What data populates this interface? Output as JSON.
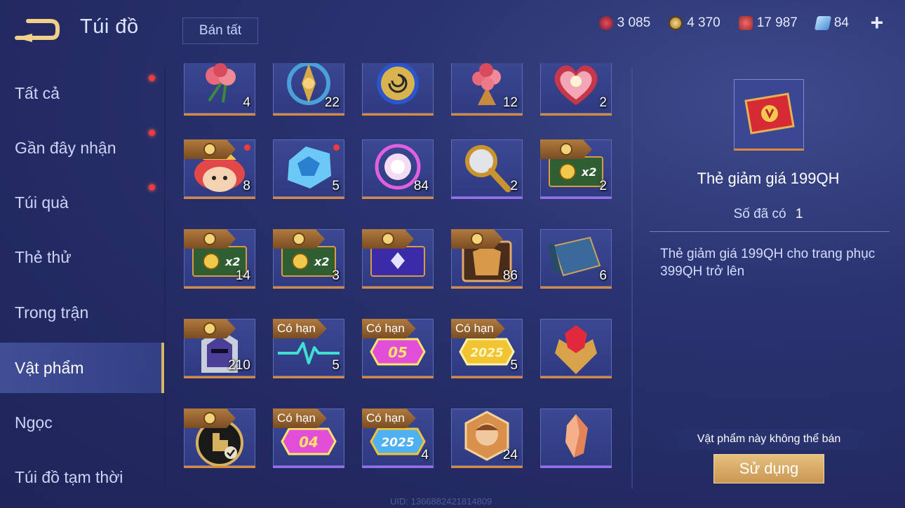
{
  "header": {
    "title": "Túi đồ",
    "sell_all": "Bán tất",
    "currencies": [
      {
        "name": "ruby-fragment",
        "value": "3 085",
        "color": "#c9344a"
      },
      {
        "name": "gold",
        "value": "4 370",
        "color": "#d9b15a"
      },
      {
        "name": "vouchers",
        "value": "17 987",
        "color": "#d8484f"
      },
      {
        "name": "tickets",
        "value": "84",
        "color": "#8fc6ff"
      }
    ],
    "plus": "+"
  },
  "sidebar": {
    "items": [
      {
        "label": "Tất cả",
        "dot": true
      },
      {
        "label": "Gần đây nhận",
        "dot": true
      },
      {
        "label": "Túi quà",
        "dot": true
      },
      {
        "label": "Thẻ thử",
        "dot": false
      },
      {
        "label": "Trong trận",
        "dot": false
      },
      {
        "label": "Vật phẩm",
        "dot": false,
        "active": true
      },
      {
        "label": "Ngọc",
        "dot": false
      },
      {
        "label": "Túi đồ tạm thời",
        "dot": false
      }
    ]
  },
  "grid": {
    "rows": [
      [
        {
          "icon": "roses-icon",
          "qty": "4",
          "rarity": "orange"
        },
        {
          "icon": "golden-crest-icon",
          "qty": "22",
          "rarity": "orange"
        },
        {
          "icon": "spiral-coin-icon",
          "qty": "",
          "rarity": "orange"
        },
        {
          "icon": "rose-bouquet-icon",
          "qty": "12",
          "rarity": "orange"
        },
        {
          "icon": "heart-gift-box-icon",
          "qty": "2",
          "rarity": "orange"
        }
      ],
      [
        {
          "icon": "lion-dance-icon",
          "qty": "8",
          "rarity": "orange",
          "tag": "coin",
          "dot": true
        },
        {
          "icon": "ice-crystal-icon",
          "qty": "5",
          "rarity": "orange",
          "dot": true
        },
        {
          "icon": "pink-orb-icon",
          "qty": "84",
          "rarity": "orange"
        },
        {
          "icon": "magnifier-scepter-icon",
          "qty": "2",
          "rarity": "purple"
        },
        {
          "icon": "gold-card-x2-icon",
          "qty": "2",
          "rarity": "purple",
          "tag": "coin",
          "card": "x2"
        }
      ],
      [
        {
          "icon": "gold-card-x2-icon",
          "qty": "14",
          "rarity": "orange",
          "tag": "coin",
          "card": "x2"
        },
        {
          "icon": "gold-card-x2-icon",
          "qty": "3",
          "rarity": "orange",
          "tag": "coin",
          "card": "x2"
        },
        {
          "icon": "purple-card-icon",
          "qty": "",
          "rarity": "orange",
          "tag": "coin"
        },
        {
          "icon": "golden-armor-chest-icon",
          "qty": "86",
          "rarity": "orange",
          "tag": "coin"
        },
        {
          "icon": "scroll-map-icon",
          "qty": "6",
          "rarity": "orange"
        }
      ],
      [
        {
          "icon": "knight-helmet-icon",
          "qty": "210",
          "rarity": "orange",
          "tag": "coin"
        },
        {
          "icon": "heartbeat-line-icon",
          "qty": "5",
          "rarity": "orange",
          "tag": "limited"
        },
        {
          "icon": "badge-05-icon",
          "qty": "",
          "rarity": "orange",
          "tag": "limited",
          "badge": "05"
        },
        {
          "icon": "badge-2025-icon",
          "qty": "5",
          "rarity": "orange",
          "tag": "limited",
          "badge": "2025"
        },
        {
          "icon": "ruby-emblem-icon",
          "qty": "",
          "rarity": "orange"
        }
      ],
      [
        {
          "icon": "tap-check-icon",
          "qty": "",
          "rarity": "orange",
          "tag": "coin"
        },
        {
          "icon": "badge-04-icon",
          "qty": "",
          "rarity": "purple",
          "tag": "limited",
          "badge": "04"
        },
        {
          "icon": "badge-2025-blue-icon",
          "qty": "4",
          "rarity": "purple",
          "tag": "limited",
          "badge": "2025"
        },
        {
          "icon": "hero-portrait-icon",
          "qty": "24",
          "rarity": "orange"
        },
        {
          "icon": "copper-crystal-icon",
          "qty": "",
          "rarity": "purple"
        }
      ]
    ],
    "limited_label": "Có hạn"
  },
  "detail": {
    "name": "Thẻ giảm giá 199QH",
    "owned_label": "Số đã có",
    "owned_value": "1",
    "description": "Thẻ giảm giá 199QH cho trang phục 399QH trở lên",
    "not_sellable": "Vật phẩm này không thể bán",
    "use_button": "Sử dụng",
    "icon": "discount-ticket-icon"
  },
  "footer": {
    "uid": "UID: 1366882421814809"
  }
}
